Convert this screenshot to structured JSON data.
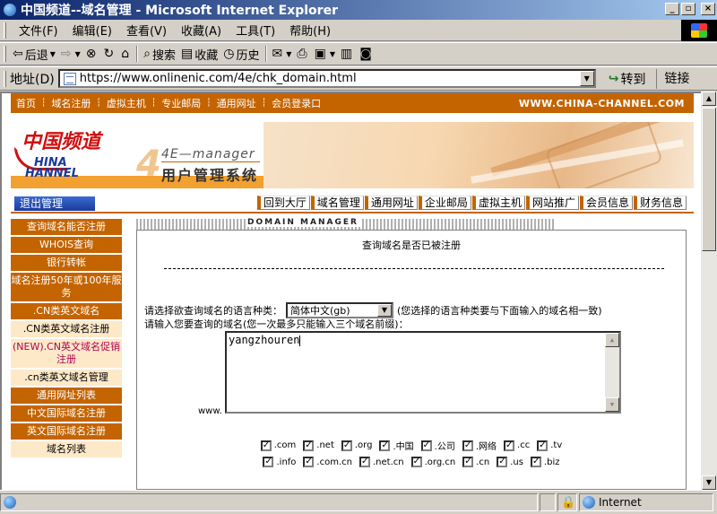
{
  "window": {
    "title": "中国频道--域名管理 - Microsoft Internet Explorer",
    "minimize": "_",
    "maximize": "▫",
    "close": "×"
  },
  "menu": [
    "文件(F)",
    "编辑(E)",
    "查看(V)",
    "收藏(A)",
    "工具(T)",
    "帮助(H)"
  ],
  "toolbar": {
    "back": "后退",
    "search": "搜索",
    "favorites": "收藏",
    "history": "历史"
  },
  "address": {
    "label": "地址(D)",
    "url": "https://www.onlinenic.com/4e/chk_domain.html",
    "go": "转到",
    "links": "链接"
  },
  "site": {
    "topnav": [
      "首页",
      "域名注册",
      "虚拟主机",
      "专业邮局",
      "通用网址",
      "会员登录口"
    ],
    "brand": "WWW.CHINA-CHANNEL.COM",
    "logo_cn": "中国频道",
    "logo_en1": "HINA",
    "logo_en2": "HANNEL",
    "em_four": "4",
    "em_line1": "4E—manager",
    "em_line2": "用户管理系统",
    "logout": "退出管理",
    "subnav": [
      "回到大厅",
      "域名管理",
      "通用网址",
      "企业邮局",
      "虚拟主机",
      "网站推广",
      "会员信息",
      "财务信息"
    ],
    "sidebar": [
      {
        "label": "查询域名能否注册",
        "style": "dark"
      },
      {
        "label": "WHOIS查询",
        "style": "dark"
      },
      {
        "label": "银行转帐",
        "style": "dark"
      },
      {
        "label": "域名注册50年或100年服务",
        "style": "dark"
      },
      {
        "label": ".CN类英文域名",
        "style": "dark"
      },
      {
        "label": ".CN类英文域名注册",
        "style": "light"
      },
      {
        "label": "(NEW).CN英文域名促销注册",
        "style": "new"
      },
      {
        "label": ".cn类英文域名管理",
        "style": "light"
      },
      {
        "label": "通用网址列表",
        "style": "dark"
      },
      {
        "label": "中文国际域名注册",
        "style": "dark"
      },
      {
        "label": "英文国际域名注册",
        "style": "dark"
      },
      {
        "label": "域名列表",
        "style": "light"
      }
    ],
    "domain_manager": "DOMAIN MANAGER",
    "form_title": "查询域名是否已被注册",
    "lang_prompt": "请选择欲查询域名的语言种类：",
    "lang_value": "简体中文(gb)",
    "lang_note": "(您选择的语言种类要与下面输入的域名相一致)",
    "domain_prompt": "请输入您要查询的域名(您一次最多只能输入三个域名前缀)：",
    "www": "www.",
    "domain_input": "yangzhouren",
    "tlds_row1": [
      ".com",
      ".net",
      ".org",
      ".中国",
      ".公司",
      ".网络",
      ".cc",
      ".tv"
    ],
    "tlds_row2": [
      ".info",
      ".com.cn",
      ".net.cn",
      ".org.cn",
      ".cn",
      ".us",
      ".biz"
    ]
  },
  "status": {
    "zone": "Internet"
  }
}
